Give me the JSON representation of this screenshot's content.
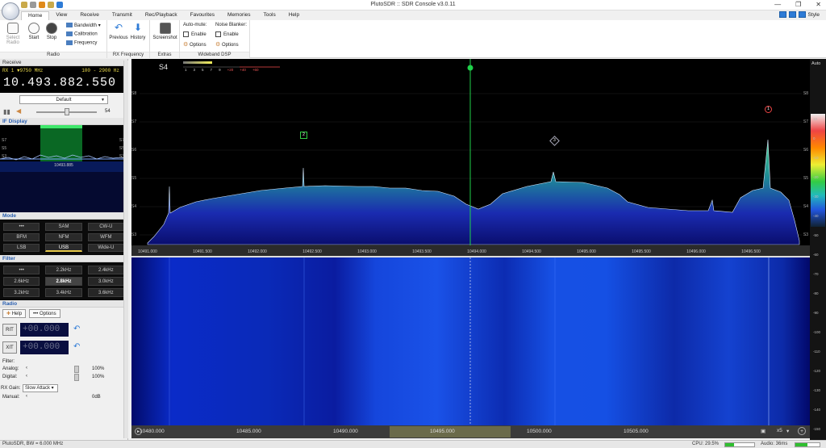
{
  "window": {
    "title": "PlutoSDR :: SDR Console v3.0.11",
    "style_label": "Style"
  },
  "tabs": [
    "Home",
    "View",
    "Receive",
    "Transmit",
    "Rec/Playback",
    "Favourites",
    "Memories",
    "Tools",
    "Help"
  ],
  "ribbon": {
    "radio": {
      "label": "Radio",
      "select_radio": "Select Radio",
      "start": "Start",
      "stop": "Stop",
      "bandwidth": "Bandwidth",
      "calibration": "Calibration",
      "frequency": "Frequency"
    },
    "rxfreq": {
      "label": "RX Frequency",
      "previous": "Previous",
      "history": "History"
    },
    "extras": {
      "label": "Extras",
      "screenshot": "Screenshot"
    },
    "wdsp": {
      "label": "Wideband DSP",
      "automute": "Auto-mute:",
      "enable1": "Enable",
      "options1": "Options",
      "noise_blanker": "Noise Blanker:",
      "enable2": "Enable",
      "options2": "Options"
    }
  },
  "left": {
    "receive_header": "Receive",
    "rx_line": "RX 1 ▼9750 MHz",
    "bw_line": "100 - 2900 Hz",
    "frequency": "10.493.882.550",
    "preset": "Default",
    "volume": "54",
    "if_header": "IF Display",
    "if_freq": "10493.885",
    "if_ticks": [
      "S7",
      "S5",
      "S3"
    ],
    "mode_header": "Mode",
    "modes": [
      "•••",
      "SAM",
      "CW-U",
      "BFM",
      "NFM",
      "WFM",
      "LSB",
      "USB",
      "Wide-U"
    ],
    "selected_mode": "USB",
    "filter_header": "Filter",
    "filters": [
      "•••",
      "2.2kHz",
      "2.4kHz",
      "2.6kHz",
      "2.8kHz",
      "3.0kHz",
      "3.2kHz",
      "3.4kHz",
      "3.6kHz"
    ],
    "selected_filter": "2.8kHz",
    "radio_header": "Radio",
    "help": "Help",
    "options": "••• Options",
    "rit": "RIT",
    "xit": "XIT",
    "rit_value": "+00.000",
    "xit_value": "+00.000",
    "filter_label": "Filter:",
    "analog": "Analog:",
    "analog_val": "100%",
    "digital": "Digital:",
    "digital_val": "100%",
    "rxgain": "RX Gain:",
    "rxgain_mode": "Slow Attack",
    "manual": "Manual:",
    "manual_val": "0dB"
  },
  "spectrum": {
    "s_label": "S4",
    "smeter_ticks": [
      "1",
      "3",
      "5",
      "7",
      "9",
      "+20",
      "+40",
      "+60"
    ],
    "left_ticks": [
      "S8",
      "S7",
      "S6",
      "S5",
      "S4",
      "S3"
    ],
    "freq_ticks": [
      "10491.000",
      "10491.500",
      "10492.000",
      "10492.500",
      "10493.000",
      "10493.500",
      "10494.000",
      "10494.500",
      "10495.000",
      "10495.500",
      "10496.000",
      "10496.500"
    ],
    "markers": [
      "1",
      "2",
      "3"
    ],
    "auto": "Auto"
  },
  "waterfall": {
    "ticks": [
      "10480.000",
      "10485.000",
      "10490.000",
      "10495.000",
      "10500.000",
      "10505.000"
    ],
    "zoom": "x5"
  },
  "right_scale": [
    "10",
    "0",
    "-10",
    "-20",
    "-30",
    "-40",
    "-50",
    "-60",
    "-70",
    "-80",
    "-90",
    "-100",
    "-110",
    "-120",
    "-130",
    "-140",
    "-150"
  ],
  "status": {
    "left": "PlutoSDR, BW = 6.000 MHz",
    "cpu": "CPU: 29.5%",
    "audio": "Audio: 36ms"
  },
  "colors": {
    "accent": "#2e7bd6",
    "tuning_line": "#1fd14a",
    "freq_yellow": "#e8d84a"
  }
}
